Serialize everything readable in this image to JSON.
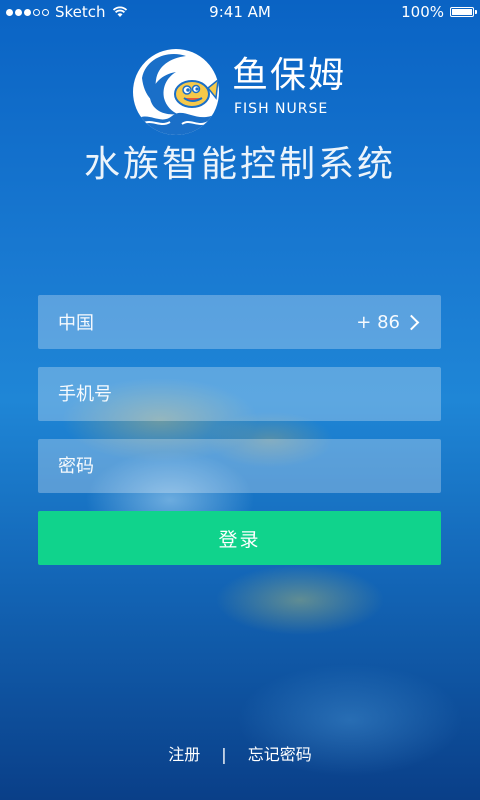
{
  "status_bar": {
    "carrier": "Sketch",
    "time": "9:41 AM",
    "battery": "100%",
    "signal_filled": 3,
    "signal_total": 5
  },
  "brand": {
    "name_cn": "鱼保姆",
    "name_en": "FISH NURSE",
    "logo_icon": "fish-nurse-logo-icon"
  },
  "app_title": "水族智能控制系统",
  "form": {
    "country_label": "中国",
    "country_code": "+ 86",
    "phone_placeholder": "手机号",
    "password_placeholder": "密码",
    "login_label": "登录"
  },
  "links": {
    "register": "注册",
    "separator": "|",
    "forgot_password": "忘记密码"
  },
  "colors": {
    "accent_green": "#10d38c",
    "background_blue": "#1a7bd2"
  }
}
